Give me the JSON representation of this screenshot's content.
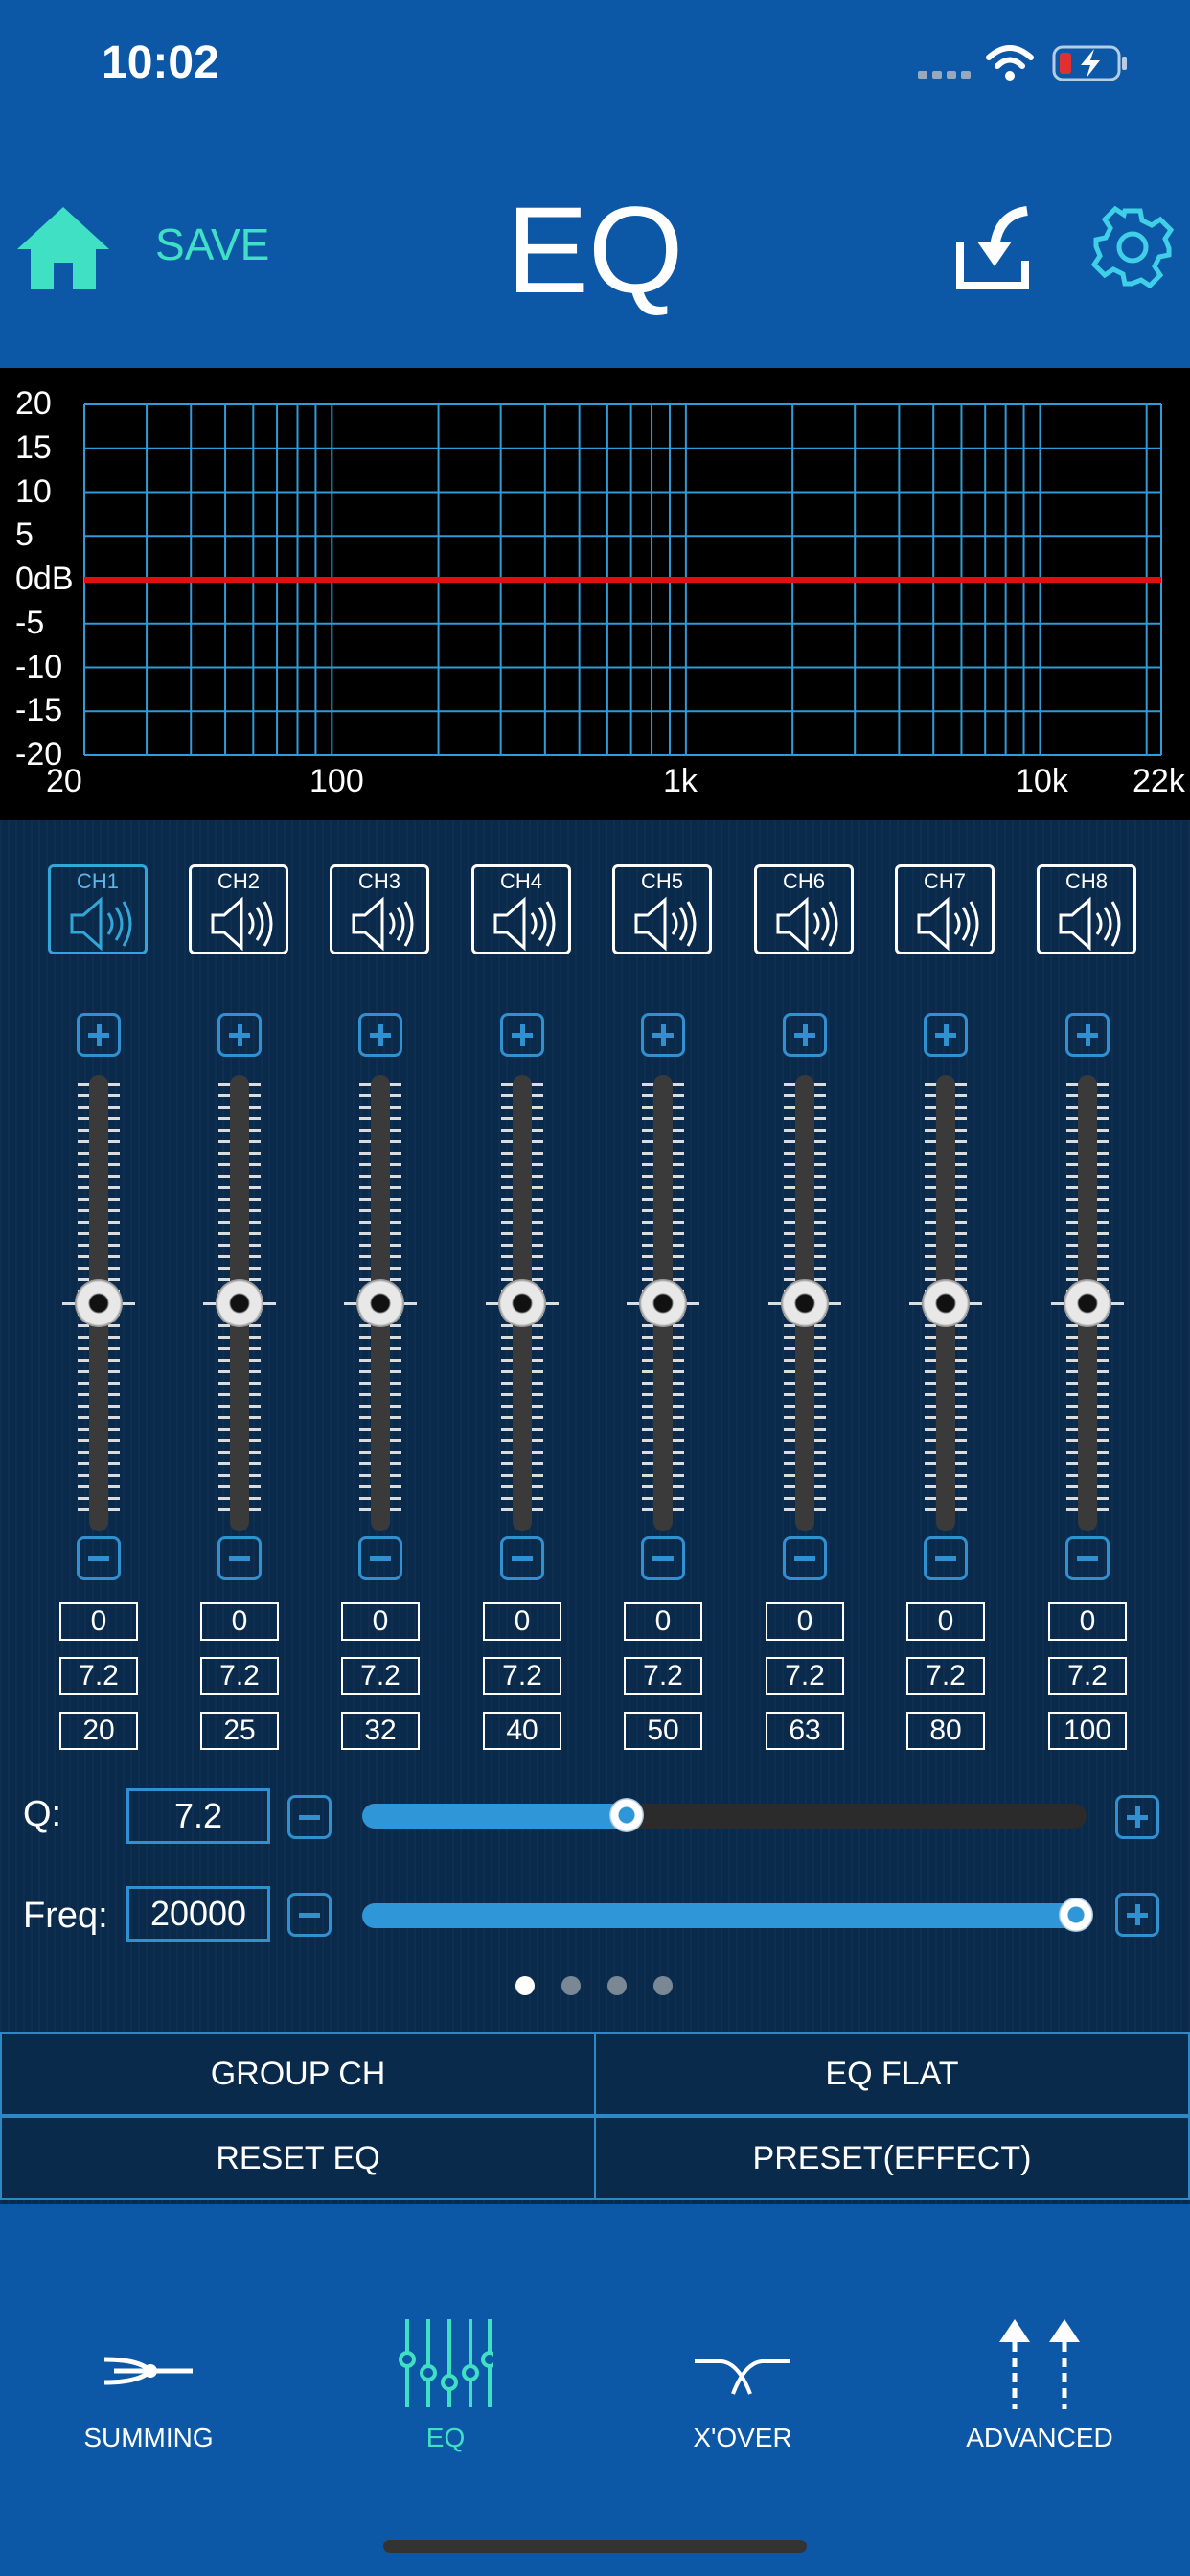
{
  "status": {
    "time": "10:02"
  },
  "header": {
    "save_label": "SAVE",
    "title": "EQ"
  },
  "graph": {
    "y_labels": [
      "20",
      "15",
      "10",
      "5",
      "0dB",
      "-5",
      "-10",
      "-15",
      "-20"
    ],
    "x_labels": [
      "20",
      "100",
      "1k",
      "10k",
      "22k"
    ],
    "grid_color": "#2f9bd9",
    "curve_color": "#e01010",
    "curve_db": 0
  },
  "channels": [
    {
      "label": "CH1",
      "active": true
    },
    {
      "label": "CH2",
      "active": false
    },
    {
      "label": "CH3",
      "active": false
    },
    {
      "label": "CH4",
      "active": false
    },
    {
      "label": "CH5",
      "active": false
    },
    {
      "label": "CH6",
      "active": false
    },
    {
      "label": "CH7",
      "active": false
    },
    {
      "label": "CH8",
      "active": false
    }
  ],
  "bands": [
    {
      "gain": "0",
      "q": "7.2",
      "freq": "20",
      "level": 0.5
    },
    {
      "gain": "0",
      "q": "7.2",
      "freq": "25",
      "level": 0.5
    },
    {
      "gain": "0",
      "q": "7.2",
      "freq": "32",
      "level": 0.5
    },
    {
      "gain": "0",
      "q": "7.2",
      "freq": "40",
      "level": 0.5
    },
    {
      "gain": "0",
      "q": "7.2",
      "freq": "50",
      "level": 0.5
    },
    {
      "gain": "0",
      "q": "7.2",
      "freq": "63",
      "level": 0.5
    },
    {
      "gain": "0",
      "q": "7.2",
      "freq": "80",
      "level": 0.5
    },
    {
      "gain": "0",
      "q": "7.2",
      "freq": "100",
      "level": 0.5
    }
  ],
  "q_control": {
    "label": "Q:",
    "value": "7.2",
    "fraction": 0.365
  },
  "freq_control": {
    "label": "Freq:",
    "value": "20000",
    "fraction": 0.985
  },
  "pages": {
    "count": 4,
    "active": 0
  },
  "buttons": {
    "group_ch": "GROUP CH",
    "eq_flat": "EQ FLAT",
    "reset_eq": "RESET EQ",
    "preset_effect": "PRESET(EFFECT)"
  },
  "tabs": [
    {
      "label": "SUMMING",
      "icon": "summing-icon",
      "active": false
    },
    {
      "label": "EQ",
      "icon": "eq-icon",
      "active": true
    },
    {
      "label": "X'OVER",
      "icon": "crossover-icon",
      "active": false
    },
    {
      "label": "ADVANCED",
      "icon": "advanced-icon",
      "active": false
    }
  ],
  "colors": {
    "accent": "#3fe0c4",
    "primary_bg": "#0d58a6",
    "panel_bg": "#0a2a4c",
    "control_blue": "#2f96d8"
  }
}
